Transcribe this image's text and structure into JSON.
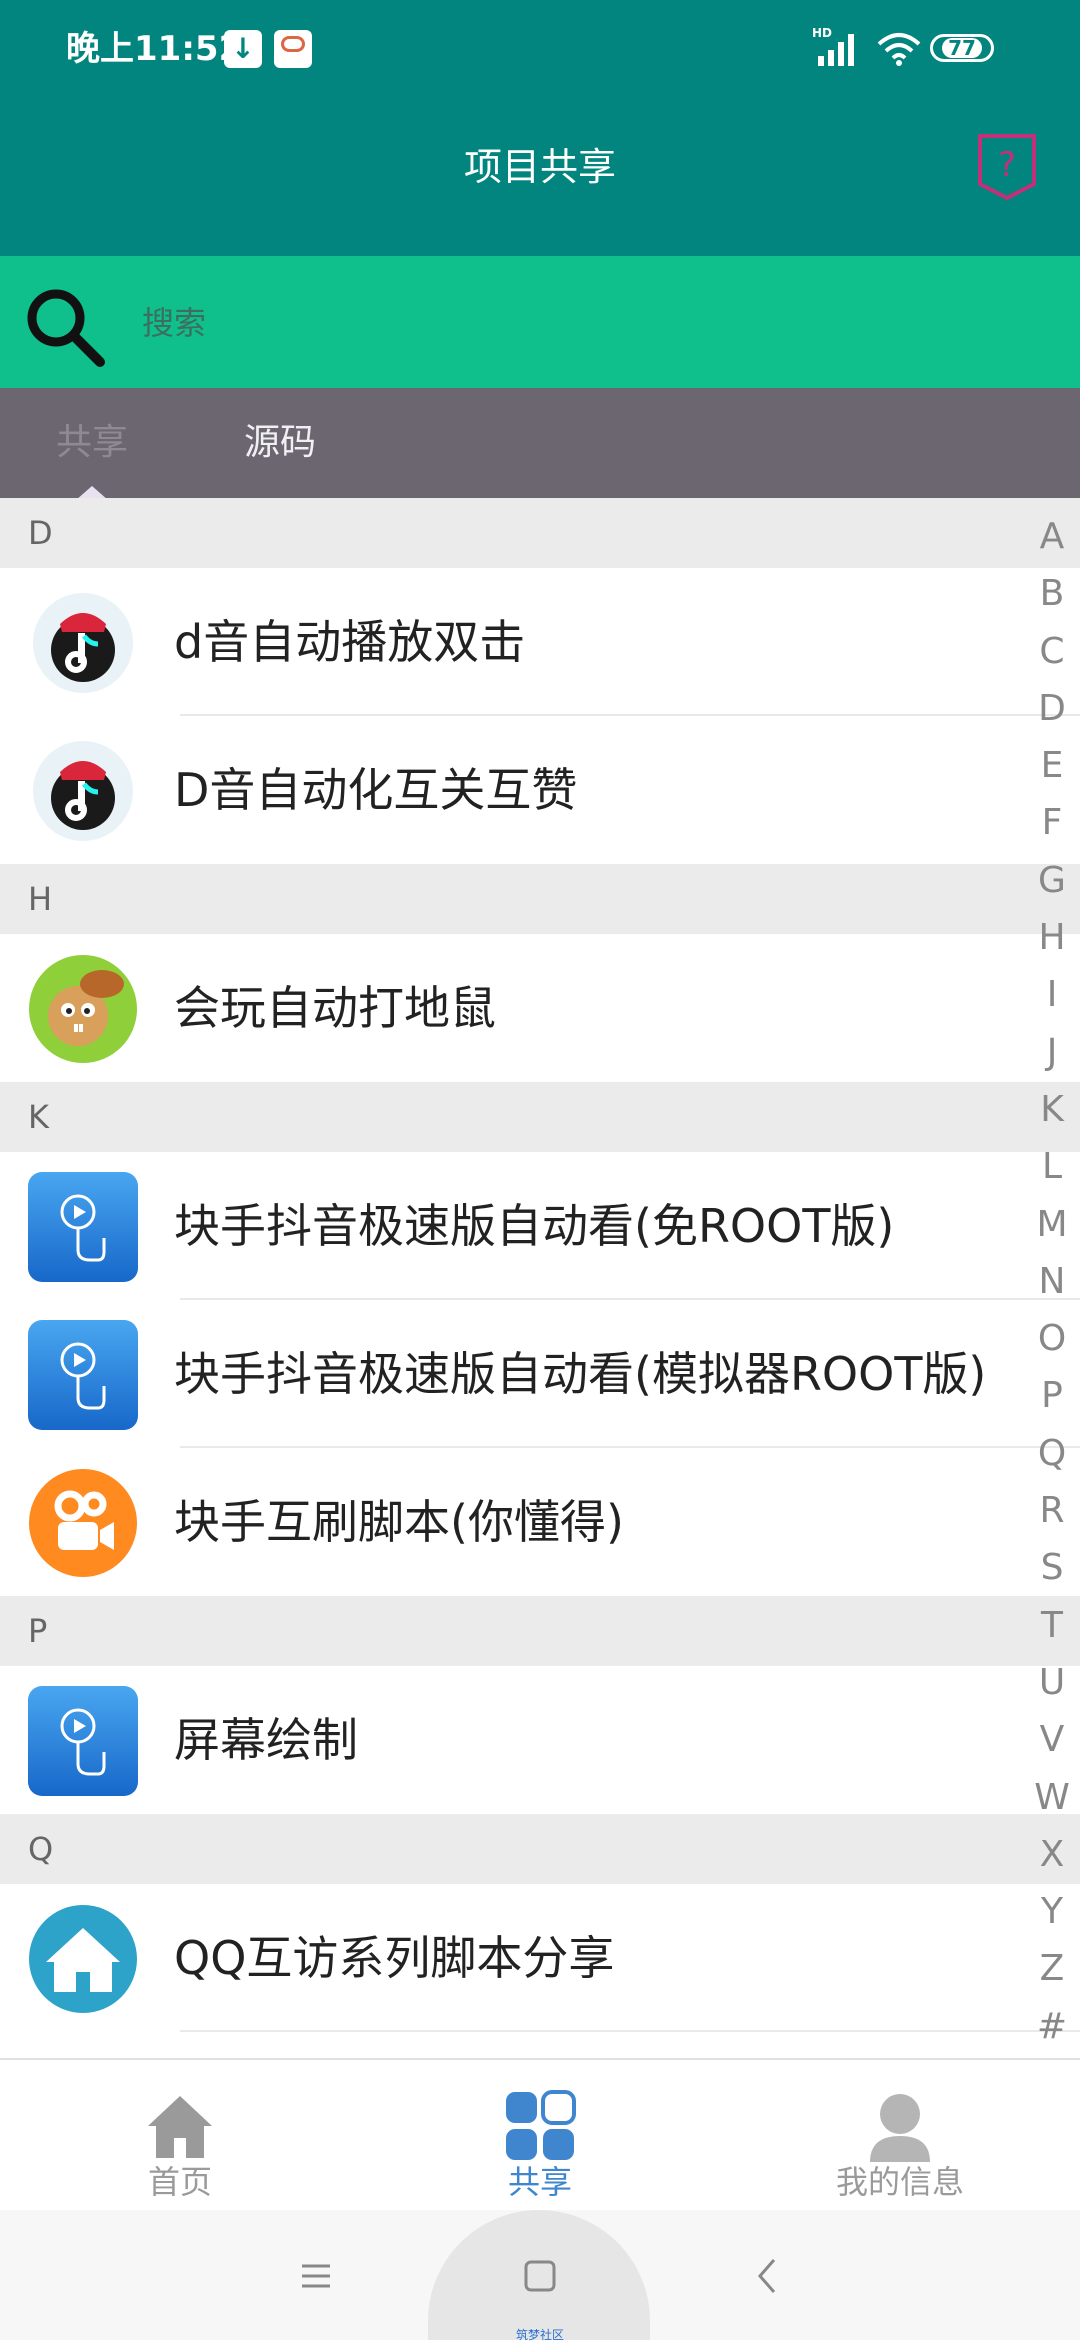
{
  "status_bar": {
    "time": "晚上11:52",
    "network": "HD",
    "battery": "77"
  },
  "header": {
    "title": "项目共享"
  },
  "search": {
    "placeholder": "搜索"
  },
  "tabs": [
    {
      "label": "共享",
      "active": true
    },
    {
      "label": "源码",
      "active": false
    }
  ],
  "sections": [
    {
      "letter": "D",
      "items": [
        {
          "label": "d音自动播放双击",
          "icon": "tiktok-mascot-icon"
        },
        {
          "label": "D音自动化互关互赞",
          "icon": "tiktok-mascot-icon"
        }
      ]
    },
    {
      "letter": "H",
      "items": [
        {
          "label": "会玩自动打地鼠",
          "icon": "hamster-game-icon"
        }
      ]
    },
    {
      "letter": "K",
      "items": [
        {
          "label": "块手抖音极速版自动看(免ROOT版)",
          "icon": "tap-play-icon"
        },
        {
          "label": "块手抖音极速版自动看(模拟器ROOT版)",
          "icon": "tap-play-icon"
        },
        {
          "label": "块手互刷脚本(你懂得)",
          "icon": "kuaishou-camera-icon"
        }
      ]
    },
    {
      "letter": "P",
      "items": [
        {
          "label": "屏幕绘制",
          "icon": "tap-play-icon"
        }
      ]
    },
    {
      "letter": "Q",
      "items": [
        {
          "label": "QQ互访系列脚本分享",
          "icon": "house-icon"
        }
      ]
    }
  ],
  "alphabet": [
    "A",
    "B",
    "C",
    "D",
    "E",
    "F",
    "G",
    "H",
    "I",
    "J",
    "K",
    "L",
    "M",
    "N",
    "O",
    "P",
    "Q",
    "R",
    "S",
    "T",
    "U",
    "V",
    "W",
    "X",
    "Y",
    "Z",
    "#"
  ],
  "bottom_nav": [
    {
      "label": "首页",
      "icon": "home-icon",
      "active": false
    },
    {
      "label": "共享",
      "icon": "grid-icon",
      "active": true
    },
    {
      "label": "我的信息",
      "icon": "user-icon",
      "active": false
    }
  ],
  "system_nav": {
    "community_label": "筑梦社区"
  },
  "colors": {
    "header_bg": "#02857e",
    "search_bg": "#0fbf8c",
    "tabs_bg": "#6b6670",
    "nav_active": "#3f86cf",
    "nav_inactive": "#9a9a9a"
  }
}
